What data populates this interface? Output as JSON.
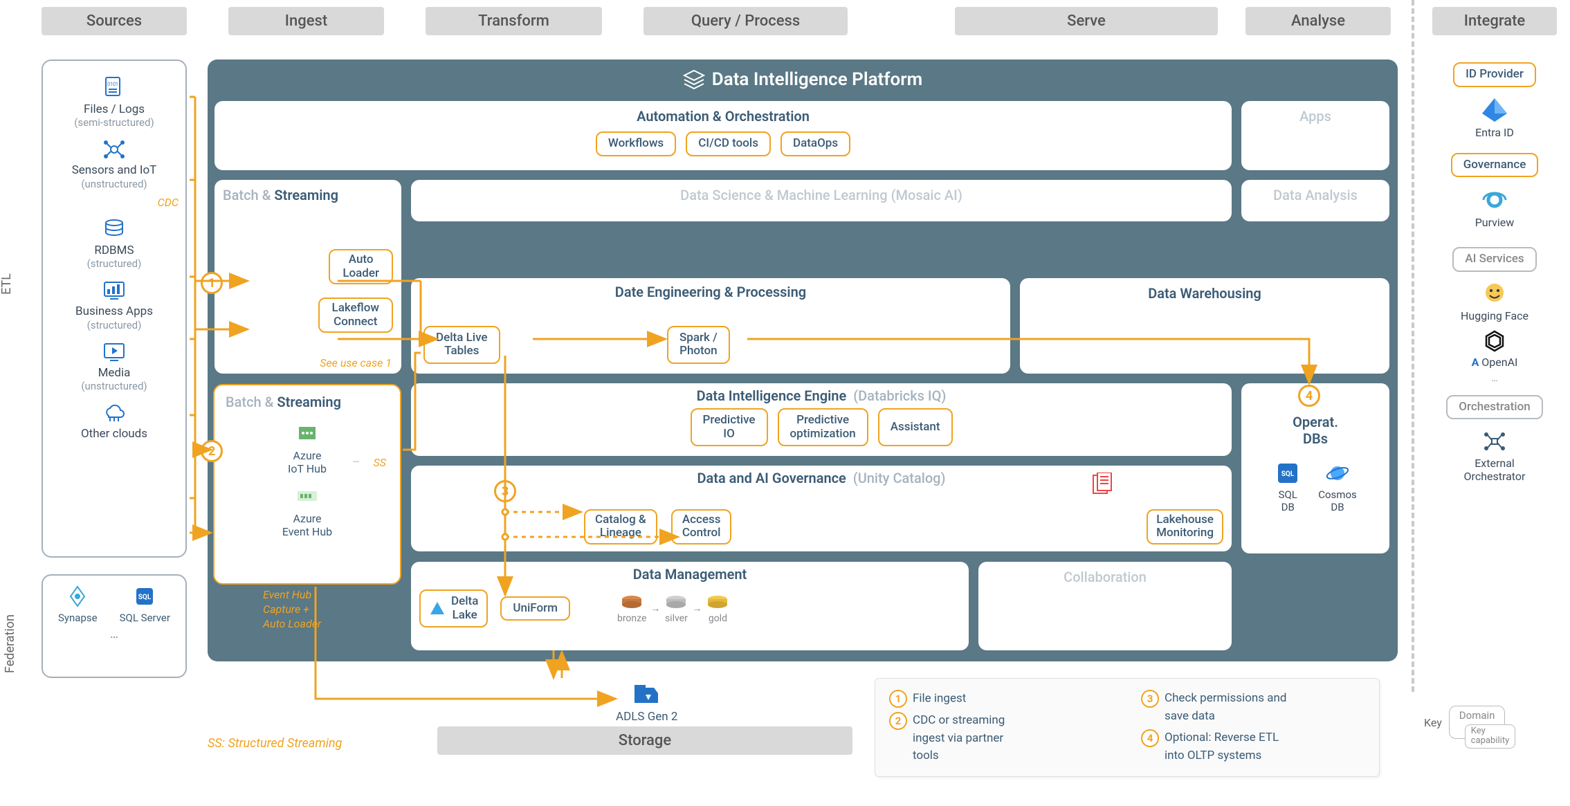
{
  "columns": {
    "sources": "Sources",
    "ingest": "Ingest",
    "transform": "Transform",
    "query": "Query / Process",
    "serve": "Serve",
    "analyse": "Analyse",
    "integrate": "Integrate"
  },
  "side": {
    "etl": "ETL",
    "federation": "Federation"
  },
  "sources": {
    "files": {
      "title": "Files / Logs",
      "sub": "(semi-structured)"
    },
    "iot": {
      "title": "Sensors and IoT",
      "sub": "(unstructured)",
      "cdc": "CDC"
    },
    "rdbms": {
      "title": "RDBMS",
      "sub": "(structured)"
    },
    "apps": {
      "title": "Business Apps",
      "sub": "(structured)"
    },
    "media": {
      "title": "Media",
      "sub": "(unstructured)"
    },
    "clouds": {
      "title": "Other clouds"
    }
  },
  "federation": {
    "synapse": "Synapse",
    "sqlserver": "SQL Server",
    "more": "…"
  },
  "platform": {
    "title": "Data Intelligence Platform"
  },
  "automation": {
    "title": "Automation & Orchestration",
    "workflows": "Workflows",
    "cicd": "CI/CD tools",
    "dataops": "DataOps"
  },
  "apps_card": "Apps",
  "batch_streaming": {
    "label_batch": "Batch & ",
    "label_stream": "Streaming"
  },
  "dsml": "Data Science & Machine Learning  (Mosaic AI)",
  "data_analysis": "Data Analysis",
  "ingest": {
    "auto_loader": "Auto\nLoader",
    "lakeflow": "Lakeflow\nConnect",
    "see_uc1": "See use case 1"
  },
  "azure": {
    "iot": "Azure\nIoT Hub",
    "event": "Azure\nEvent Hub",
    "ss": "SS",
    "note": "Event Hub\nCapture +\nAuto Loader",
    "more": "…"
  },
  "de": {
    "title": "Date Engineering & Processing",
    "dlt": "Delta Live\nTables",
    "spark": "Spark /\nPhoton"
  },
  "dw": {
    "title": "Data Warehousing"
  },
  "die": {
    "title": "Data Intelligence Engine",
    "sub": "(Databricks IQ)",
    "pio": "Predictive\nIO",
    "popt": "Predictive\noptimization",
    "assist": "Assistant"
  },
  "gov": {
    "title": "Data and AI Governance",
    "sub": "(Unity Catalog)",
    "catalog": "Catalog &\nLineage",
    "access": "Access\nControl",
    "lakemon": "Lakehouse\nMonitoring"
  },
  "dm": {
    "title": "Data Management",
    "delta": "Delta\nLake",
    "uniform": "UniForm",
    "bronze": "bronze",
    "silver": "silver",
    "gold": "gold"
  },
  "collab": "Collaboration",
  "operdb": {
    "title": "Operat.\nDBs",
    "sql": "SQL\nDB",
    "cosmos": "Cosmos\nDB"
  },
  "storage": {
    "adls": "ADLS Gen 2",
    "title": "Storage"
  },
  "ss_note": "SS: Structured Streaming",
  "legend": {
    "l1": "File ingest",
    "l2": "CDC or streaming\ningest via partner\ntools",
    "l3": "Check permissions and\nsave data",
    "l4": "Optional: Reverse ETL\ninto OLTP systems"
  },
  "integrate": {
    "idp": "ID Provider",
    "entra": "Entra ID",
    "gov": "Governance",
    "purview": "Purview",
    "ai": "AI Services",
    "hf": "Hugging Face",
    "openai": "OpenAI",
    "azureA": "A",
    "more": "…",
    "orch": "Orchestration",
    "ext": "External\nOrchestrator"
  },
  "key": {
    "label": "Key",
    "domain": "Domain",
    "cap": "Key\ncapability"
  },
  "nums": {
    "n1": "1",
    "n2": "2",
    "n3": "3",
    "n4": "4"
  }
}
